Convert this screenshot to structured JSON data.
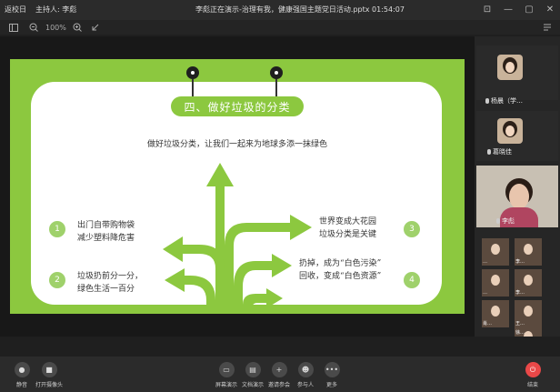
{
  "titlebar": {
    "back_label": "返校日",
    "host_label": "主持人: 李彪",
    "window_title": "李彪正在演示-治理有我，健康强国主题党日活动.pptx 01:54:07"
  },
  "toolbar": {
    "zoom_label": "100%"
  },
  "slide": {
    "heading": "四、做好垃圾的分类",
    "subtitle": "做好垃圾分类，让我们一起来为地球多添一抹绿色",
    "points": [
      {
        "num": "1",
        "line1": "出门自带购物袋",
        "line2": "减少塑料降危害"
      },
      {
        "num": "2",
        "line1": "垃圾扔前分一分，",
        "line2": "绿色生活一百分"
      },
      {
        "num": "3",
        "line1": "世界变成大花园",
        "line2": "垃圾分类是关键"
      },
      {
        "num": "4",
        "line1": "扔掉，成为“白色污染”",
        "line2": "回收，变成“白色资源”"
      }
    ],
    "colors": {
      "green": "#8cc83f",
      "light_green": "#9fd16b"
    }
  },
  "participants": {
    "p1_name": "杨晨（学…",
    "p2_name": "葛晓佳",
    "video_name": "李彪",
    "thumbs": [
      "…",
      "李…",
      "…",
      "李…",
      "肖…",
      "王…",
      "徐…"
    ]
  },
  "bottombar": {
    "mute": "静音",
    "camera": "打开摄像头",
    "screen_share": "屏幕演示",
    "doc_share": "文档演示",
    "invite": "邀请参会",
    "participants": "参与人",
    "more": "更多",
    "end": "结束"
  }
}
